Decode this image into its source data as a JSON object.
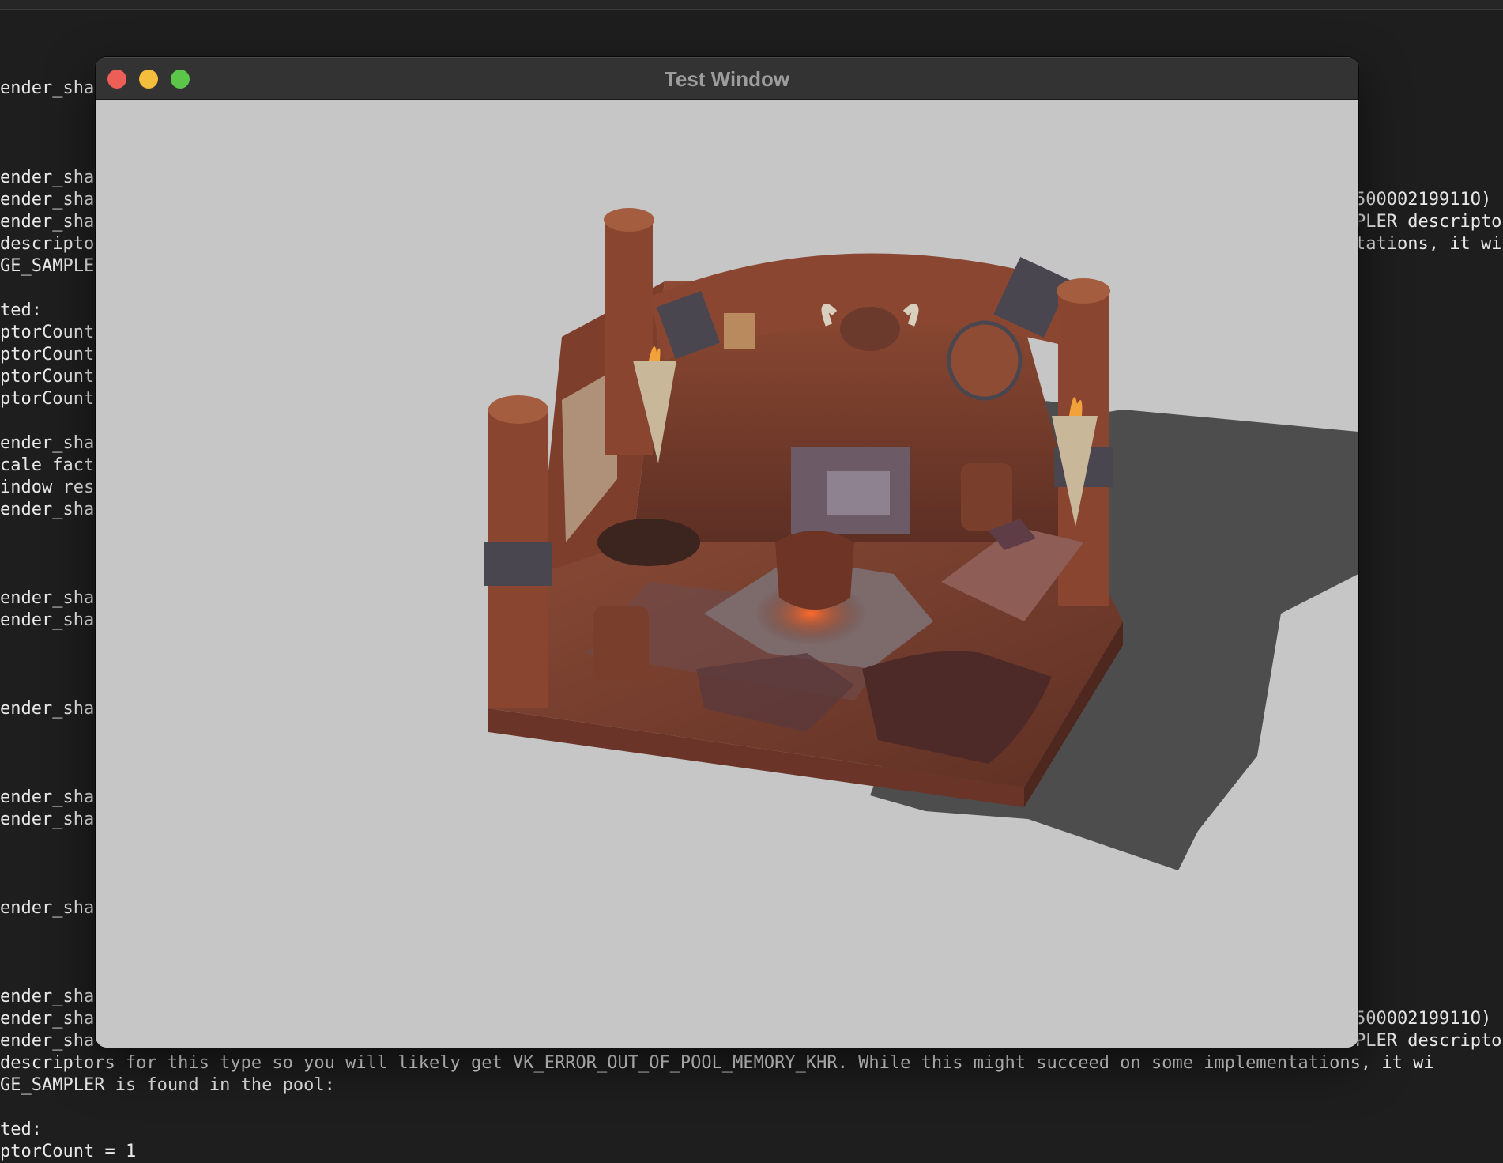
{
  "window": {
    "title": "Test Window",
    "controls": {
      "close": "close",
      "minimize": "minimize",
      "maximize": "zoom"
    }
  },
  "terminal": {
    "left_fragments": [
      "ender_sha",
      "ender_sha",
      "ender_sha",
      "ender_sha",
      "descripto",
      "GE_SAMPLE",
      "ted:",
      "ptorCount",
      "ptorCount",
      "ptorCount",
      "ptorCount",
      "ender_sha",
      "cale fact",
      "indow res",
      "ender_sha",
      "ender_sha",
      "ender_sha",
      "ender_sha",
      "ender_sha",
      "ender_sha",
      "ender_sha",
      "ender_sha",
      "ender_sha",
      "ender_sha"
    ],
    "right_fragments": [
      "50000219911O)",
      "PLER descripto",
      "tations, it wi",
      "50000219911O)",
      "PLER descripto"
    ],
    "bottom_lines": [
      "descriptors for this type so you will likely get VK_ERROR_OUT_OF_POOL_MEMORY_KHR. While this might succeed on some implementations, it wi",
      "GE_SAMPLER is found in the pool:",
      "",
      "ted:",
      "ptorCount = 1"
    ]
  },
  "scene": {
    "background": "#c6c6c6",
    "shadow": "#4d4d4d",
    "wood": "#7a3f2c",
    "wood_dark": "#4f2a22",
    "metal": "#4a4650",
    "flame": "#f2a23a",
    "fire_glow": "#c94a22",
    "description": "3D tavern diorama render"
  }
}
